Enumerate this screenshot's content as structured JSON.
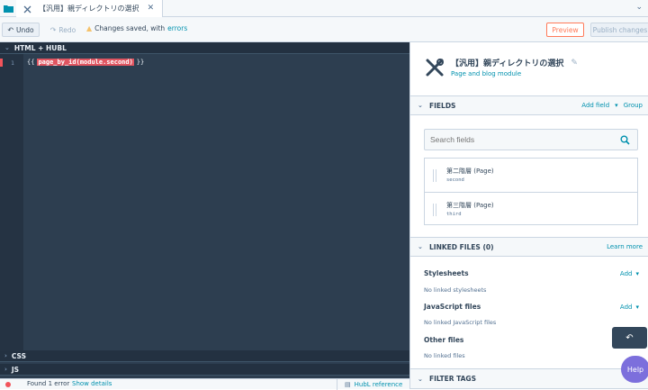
{
  "tab": {
    "title": "【汎用】親ディレクトリの選択"
  },
  "toolbar": {
    "undo": "Undo",
    "redo": "Redo",
    "status": "Changes saved, with",
    "status_link": "errors",
    "preview": "Preview",
    "publish": "Publish changes"
  },
  "editor": {
    "sections": [
      "HTML + HUBL",
      "CSS",
      "JS"
    ],
    "line_number": "1",
    "open_brace": "{{",
    "code": "page_by_id(module.second)",
    "close_brace": "}}"
  },
  "bottom": {
    "error_text": "Found 1 error",
    "details_link": "Show details",
    "reference": "HubL reference"
  },
  "module": {
    "title": "【汎用】親ディレクトリの選択",
    "subtitle": "Page and blog module"
  },
  "fields_panel": {
    "heading": "FIELDS",
    "add_field": "Add field",
    "group": "Group",
    "search_placeholder": "Search fields",
    "items": [
      {
        "label": "第二階層 (Page)",
        "name": "second"
      },
      {
        "label": "第三階層 (Page)",
        "name": "third"
      }
    ]
  },
  "linked_files": {
    "heading": "LINKED FILES (0)",
    "learn_more": "Learn more",
    "groups": [
      {
        "title": "Stylesheets",
        "add": "Add",
        "empty": "No linked stylesheets"
      },
      {
        "title": "JavaScript files",
        "add": "Add",
        "empty": "No linked JavaScript files"
      },
      {
        "title": "Other files",
        "empty": "No linked files"
      }
    ]
  },
  "filter_tags": {
    "heading": "FILTER TAGS"
  },
  "help": {
    "label": "Help"
  },
  "colors": {
    "accent": "#0091ae",
    "orange": "#ff7a59",
    "error": "#f2545b",
    "editor_bg": "#2d3e50",
    "help": "#7c6fdc"
  }
}
